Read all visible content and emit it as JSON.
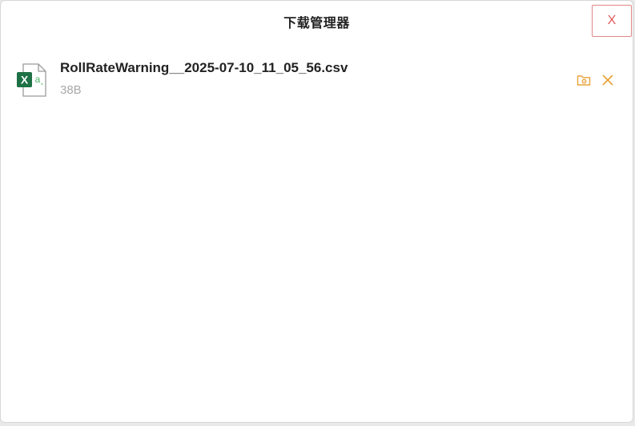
{
  "dialog": {
    "title": "下载管理器",
    "close_label": "X"
  },
  "downloads": [
    {
      "file_name": "RollRateWarning__2025-07-10_11_05_56.csv",
      "file_size": "38B",
      "icon": "excel-file-icon",
      "actions": [
        "open-folder-icon",
        "remove-icon"
      ]
    }
  ],
  "colors": {
    "close_border": "#e08686",
    "close_text": "#e05a5a",
    "action_accent": "#e8a33a",
    "excel_green": "#1e7145",
    "size_text": "#a8a8a8"
  }
}
